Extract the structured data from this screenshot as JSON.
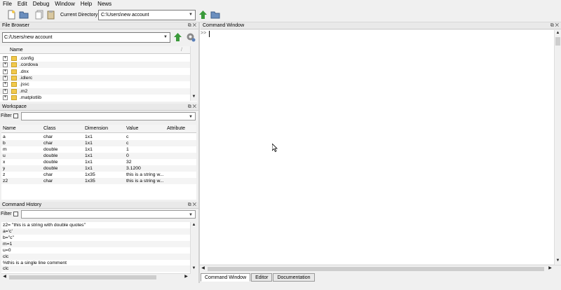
{
  "menu": [
    "File",
    "Edit",
    "Debug",
    "Window",
    "Help",
    "News"
  ],
  "toolbar": {
    "current_dir_label": "Current Directory:",
    "current_dir_value": "C:\\Users\\new account"
  },
  "file_browser": {
    "title": "File Browser",
    "path": "C:/Users/new account",
    "column": "Name",
    "items": [
      ".config",
      ".cordova",
      ".dnx",
      ".idlerc",
      ".jssc",
      ".m2",
      ".matplotlib"
    ]
  },
  "workspace": {
    "title": "Workspace",
    "filter_label": "Filter",
    "columns": [
      "Name",
      "Class",
      "Dimension",
      "Value",
      "Attribute"
    ],
    "rows": [
      [
        "a",
        "char",
        "1x1",
        "c",
        ""
      ],
      [
        "b",
        "char",
        "1x1",
        "c",
        ""
      ],
      [
        "m",
        "double",
        "1x1",
        "1",
        ""
      ],
      [
        "u",
        "double",
        "1x1",
        "0",
        ""
      ],
      [
        "x",
        "double",
        "1x1",
        "32",
        ""
      ],
      [
        "y",
        "double",
        "1x1",
        "3.1200",
        ""
      ],
      [
        "z",
        "char",
        "1x35",
        "this is a string w...",
        ""
      ],
      [
        "z2",
        "char",
        "1x35",
        "this is a string w...",
        ""
      ]
    ]
  },
  "history": {
    "title": "Command History",
    "filter_label": "Filter",
    "lines": [
      "z2= \"this is a string with double quotes\"",
      "a='c'",
      "b=\"c\"",
      "m=1",
      "u=0",
      "clc",
      "%this is a single line comment",
      "clc"
    ]
  },
  "command_window": {
    "title": "Command Window",
    "prompt": ">>"
  },
  "bottom_tabs": [
    "Command Window",
    "Editor",
    "Documentation"
  ],
  "panel_controls": "⧉ ✕",
  "colors": {
    "accent_green": "#3a9a3a",
    "folder": "#f2c94c"
  }
}
